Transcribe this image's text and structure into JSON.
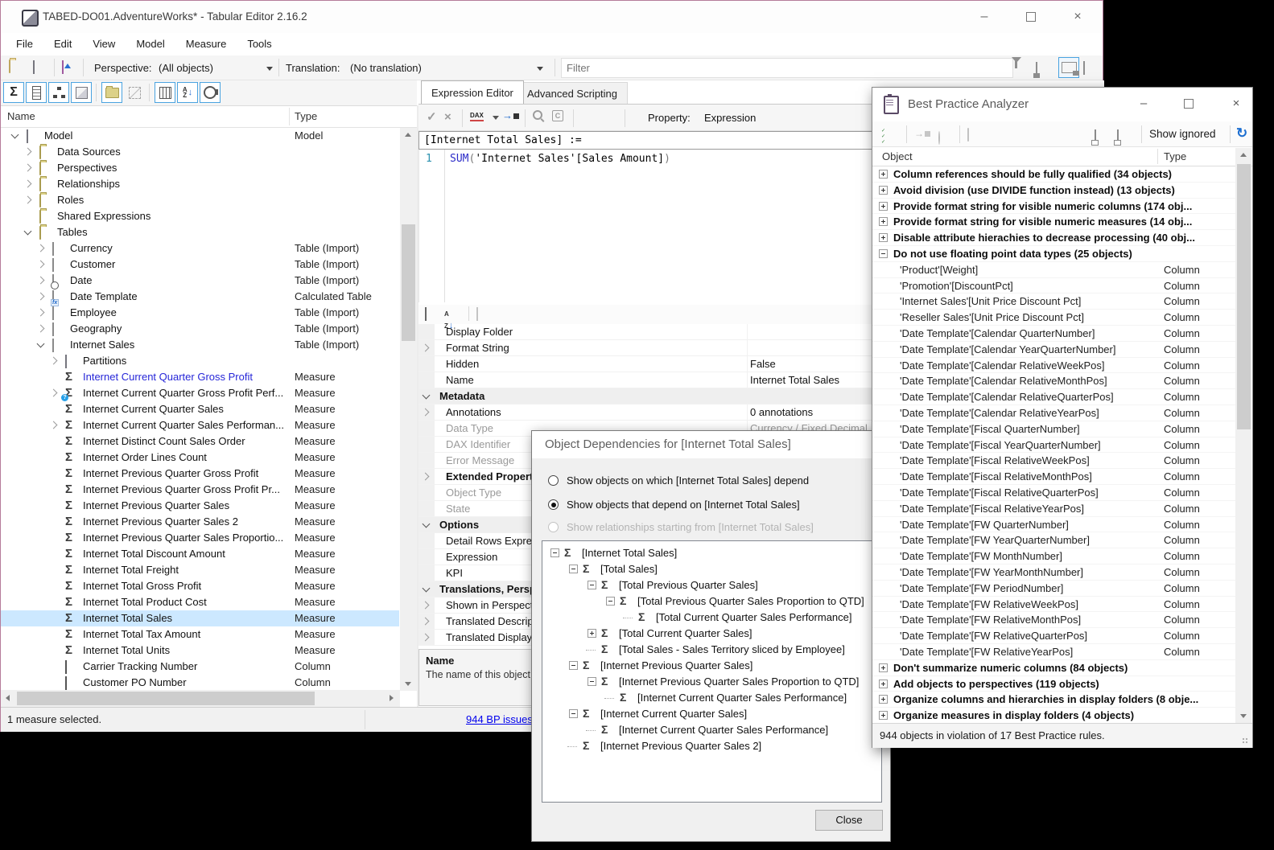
{
  "colors": {
    "selection": "#cce8ff",
    "modified_measure": "#2626d8",
    "accent_toggle_border": "#4aa3e0",
    "link": "#0000ee",
    "dax_keyword": "#2b2bc8",
    "refresh_icon": "#1d6fd1",
    "window_border": "#b57c9a",
    "desktop": "#000000",
    "kpi_badge": "#26a0e8"
  },
  "window": {
    "title": "TABED-DO01.AdventureWorks* - Tabular Editor 2.16.2"
  },
  "menu": {
    "items": [
      "File",
      "Edit",
      "View",
      "Model",
      "Measure",
      "Tools"
    ]
  },
  "toolbar": {
    "perspective_label": "Perspective:",
    "perspective_value": "(All objects)",
    "translation_label": "Translation:",
    "translation_value": "(No translation)",
    "filter_placeholder": "Filter",
    "icons": [
      "open-file-icon",
      "model-icon",
      "deploy-icon",
      "filter-funnel-icon",
      "layout-split-icon",
      "layout-split-active-icon",
      "grid-view-icon"
    ]
  },
  "object_toolbar": {
    "buttons": [
      {
        "icon": "sigma",
        "name": "toggle-measures",
        "active": true
      },
      {
        "icon": "column",
        "name": "toggle-columns",
        "active": true
      },
      {
        "icon": "hierarchy",
        "name": "toggle-hierarchies",
        "active": true
      },
      {
        "icon": "cube",
        "name": "toggle-partitions",
        "active": true
      },
      {
        "icon": "sep"
      },
      {
        "icon": "folder",
        "name": "toggle-display-folders",
        "active": true
      },
      {
        "icon": "dashed",
        "name": "toggle-hidden-objects",
        "active": false
      },
      {
        "icon": "sep"
      },
      {
        "icon": "cols3",
        "name": "toggle-metadata-columns",
        "active": true
      },
      {
        "icon": "az",
        "name": "toggle-alphabetical-sort",
        "active": true
      },
      {
        "icon": "circ",
        "name": "toggle-object-types",
        "active": true
      }
    ]
  },
  "tree": {
    "columns": [
      "Name",
      "Type"
    ],
    "items": [
      {
        "label": "Model",
        "type": "Model",
        "level": 0,
        "icon": "cube",
        "expand": "open"
      },
      {
        "label": "Data Sources",
        "type": "",
        "level": 1,
        "icon": "folder",
        "expand": "closed"
      },
      {
        "label": "Perspectives",
        "type": "",
        "level": 1,
        "icon": "folder",
        "expand": "closed"
      },
      {
        "label": "Relationships",
        "type": "",
        "level": 1,
        "icon": "folder",
        "expand": "closed"
      },
      {
        "label": "Roles",
        "type": "",
        "level": 1,
        "icon": "folder",
        "expand": "closed"
      },
      {
        "label": "Shared Expressions",
        "type": "",
        "level": 1,
        "icon": "folder",
        "expand": "none"
      },
      {
        "label": "Tables",
        "type": "",
        "level": 1,
        "icon": "folder",
        "expand": "open"
      },
      {
        "label": "Currency",
        "type": "Table (Import)",
        "level": 2,
        "icon": "table",
        "expand": "closed"
      },
      {
        "label": "Customer",
        "type": "Table (Import)",
        "level": 2,
        "icon": "table",
        "expand": "closed"
      },
      {
        "label": "Date",
        "type": "Table (Import)",
        "level": 2,
        "icon": "table-clock",
        "expand": "closed"
      },
      {
        "label": "Date Template",
        "type": "Calculated Table",
        "level": 2,
        "icon": "table-fx",
        "expand": "closed"
      },
      {
        "label": "Employee",
        "type": "Table (Import)",
        "level": 2,
        "icon": "table",
        "expand": "closed"
      },
      {
        "label": "Geography",
        "type": "Table (Import)",
        "level": 2,
        "icon": "table",
        "expand": "closed"
      },
      {
        "label": "Internet Sales",
        "type": "Table (Import)",
        "level": 2,
        "icon": "table",
        "expand": "open"
      },
      {
        "label": "Partitions",
        "type": "",
        "level": 3,
        "icon": "cube",
        "expand": "closed"
      },
      {
        "label": "Internet Current Quarter Gross Profit",
        "type": "Measure",
        "level": 3,
        "icon": "sigma",
        "expand": "none",
        "modified": true
      },
      {
        "label": "Internet Current Quarter Gross Profit Perf...",
        "type": "Measure",
        "level": 3,
        "icon": "kpi",
        "expand": "closed"
      },
      {
        "label": "Internet Current Quarter Sales",
        "type": "Measure",
        "level": 3,
        "icon": "sigma",
        "expand": "none"
      },
      {
        "label": "Internet Current Quarter Sales Performan...",
        "type": "Measure",
        "level": 3,
        "icon": "sigma",
        "expand": "closed"
      },
      {
        "label": "Internet Distinct Count Sales Order",
        "type": "Measure",
        "level": 3,
        "icon": "sigma",
        "expand": "none"
      },
      {
        "label": "Internet Order Lines Count",
        "type": "Measure",
        "level": 3,
        "icon": "sigma",
        "expand": "none"
      },
      {
        "label": "Internet Previous Quarter Gross Profit",
        "type": "Measure",
        "level": 3,
        "icon": "sigma",
        "expand": "none"
      },
      {
        "label": "Internet Previous Quarter Gross Profit Pr...",
        "type": "Measure",
        "level": 3,
        "icon": "sigma",
        "expand": "none"
      },
      {
        "label": "Internet Previous Quarter Sales",
        "type": "Measure",
        "level": 3,
        "icon": "sigma",
        "expand": "none"
      },
      {
        "label": "Internet Previous Quarter Sales 2",
        "type": "Measure",
        "level": 3,
        "icon": "sigma",
        "expand": "none"
      },
      {
        "label": "Internet Previous Quarter Sales Proportio...",
        "type": "Measure",
        "level": 3,
        "icon": "sigma",
        "expand": "none"
      },
      {
        "label": "Internet Total Discount Amount",
        "type": "Measure",
        "level": 3,
        "icon": "sigma",
        "expand": "none"
      },
      {
        "label": "Internet Total Freight",
        "type": "Measure",
        "level": 3,
        "icon": "sigma",
        "expand": "none"
      },
      {
        "label": "Internet Total Gross Profit",
        "type": "Measure",
        "level": 3,
        "icon": "sigma",
        "expand": "none"
      },
      {
        "label": "Internet Total Product Cost",
        "type": "Measure",
        "level": 3,
        "icon": "sigma",
        "expand": "none"
      },
      {
        "label": "Internet Total Sales",
        "type": "Measure",
        "level": 3,
        "icon": "sigma",
        "expand": "none",
        "selected": true
      },
      {
        "label": "Internet Total Tax Amount",
        "type": "Measure",
        "level": 3,
        "icon": "sigma",
        "expand": "none"
      },
      {
        "label": "Internet Total Units",
        "type": "Measure",
        "level": 3,
        "icon": "sigma",
        "expand": "none"
      },
      {
        "label": "Carrier Tracking Number",
        "type": "Column",
        "level": 3,
        "icon": "column",
        "expand": "none"
      },
      {
        "label": "Customer PO Number",
        "type": "Column",
        "level": 3,
        "icon": "column",
        "expand": "none"
      }
    ]
  },
  "status": {
    "left": "1 measure selected.",
    "bp_link": "944 BP issues"
  },
  "editor": {
    "tabs": [
      "Expression Editor",
      "Advanced Scripting"
    ],
    "property_label": "Property:",
    "property_value": "Expression",
    "header": "[Internet Total Sales] :=",
    "line_number": "1",
    "code": {
      "keyword": "SUM",
      "open_paren": "(",
      "body": "'Internet Sales'[Sales Amount]",
      "close_paren": ")"
    }
  },
  "properties": {
    "rows": [
      {
        "label": "Display Folder",
        "value": "",
        "kind": "row"
      },
      {
        "label": "Format String",
        "value": "",
        "kind": "row",
        "expander": true
      },
      {
        "label": "Hidden",
        "value": "False",
        "kind": "row"
      },
      {
        "label": "Name",
        "value": "Internet Total Sales",
        "kind": "row"
      },
      {
        "label": "Metadata",
        "kind": "group"
      },
      {
        "label": "Annotations",
        "value": "0 annotations",
        "kind": "row",
        "expander": true
      },
      {
        "label": "Data Type",
        "value": "Currency / Fixed Decimal",
        "kind": "row",
        "readonly": true
      },
      {
        "label": "DAX Identifier",
        "value": "",
        "kind": "row",
        "readonly": true
      },
      {
        "label": "Error Message",
        "value": "",
        "kind": "row",
        "readonly": true
      },
      {
        "label": "Extended Properties",
        "value": "",
        "kind": "row",
        "expander": true,
        "bold": true
      },
      {
        "label": "Object Type",
        "value": "",
        "kind": "row",
        "readonly": true
      },
      {
        "label": "State",
        "value": "",
        "kind": "row",
        "readonly": true
      },
      {
        "label": "Options",
        "kind": "group"
      },
      {
        "label": "Detail Rows Expression",
        "value": "",
        "kind": "row"
      },
      {
        "label": "Expression",
        "value": "",
        "kind": "row"
      },
      {
        "label": "KPI",
        "value": "",
        "kind": "row"
      },
      {
        "label": "Translations, Perspectives",
        "kind": "group"
      },
      {
        "label": "Shown in Perspectives",
        "value": "",
        "kind": "row",
        "expander": true
      },
      {
        "label": "Translated Descriptions",
        "value": "",
        "kind": "row",
        "expander": true
      },
      {
        "label": "Translated Display Folders",
        "value": "",
        "kind": "row",
        "expander": true
      }
    ],
    "description_title": "Name",
    "description_text": "The name of this object"
  },
  "dialog": {
    "title": "Object Dependencies for [Internet Total Sales]",
    "radios": [
      {
        "label": "Show objects on which [Internet Total Sales] depend",
        "selected": false,
        "disabled": false
      },
      {
        "label": "Show objects that depend on [Internet Total Sales]",
        "selected": true,
        "disabled": false
      },
      {
        "label": "Show relationships starting from [Internet Total Sales]",
        "selected": false,
        "disabled": true
      }
    ],
    "tree": [
      {
        "label": "[Internet Total Sales]",
        "level": 0,
        "box": "minus"
      },
      {
        "label": "[Total Sales]",
        "level": 1,
        "box": "minus"
      },
      {
        "label": "[Total Previous Quarter Sales]",
        "level": 2,
        "box": "minus"
      },
      {
        "label": "[Total Previous Quarter Sales Proportion to QTD]",
        "level": 3,
        "box": "minus"
      },
      {
        "label": "[Total Current Quarter Sales Performance]",
        "level": 4,
        "box": "none"
      },
      {
        "label": "[Total Current Quarter Sales]",
        "level": 2,
        "box": "plus"
      },
      {
        "label": "[Total Sales - Sales Territory sliced by Employee]",
        "level": 2,
        "box": "none"
      },
      {
        "label": "[Internet Previous Quarter Sales]",
        "level": 1,
        "box": "minus"
      },
      {
        "label": "[Internet Previous Quarter Sales Proportion to QTD]",
        "level": 2,
        "box": "minus"
      },
      {
        "label": "[Internet Current Quarter Sales Performance]",
        "level": 3,
        "box": "none"
      },
      {
        "label": "[Internet Current Quarter Sales]",
        "level": 1,
        "box": "minus"
      },
      {
        "label": "[Internet Current Quarter Sales Performance]",
        "level": 2,
        "box": "none"
      },
      {
        "label": "[Internet Previous Quarter Sales 2]",
        "level": 1,
        "box": "none"
      }
    ],
    "close_label": "Close"
  },
  "bpa": {
    "title": "Best Practice Analyzer",
    "show_ignored": "Show ignored",
    "columns": [
      "Object",
      "Type"
    ],
    "rows": [
      {
        "kind": "rule",
        "box": "plus",
        "label": "Column references should be fully qualified (34 objects)"
      },
      {
        "kind": "rule",
        "box": "plus",
        "label": "Avoid division (use DIVIDE function instead) (13 objects)"
      },
      {
        "kind": "rule",
        "box": "plus",
        "label": "Provide format string for visible numeric columns (174 obj..."
      },
      {
        "kind": "rule",
        "box": "plus",
        "label": "Provide format string for visible numeric measures (14 obj..."
      },
      {
        "kind": "rule",
        "box": "plus",
        "label": "Disable attribute hierachies to decrease processing (40 obj..."
      },
      {
        "kind": "rule",
        "box": "minus",
        "label": "Do not use floating point data types (25 objects)"
      },
      {
        "kind": "item",
        "label": "'Product'[Weight]",
        "type": "Column"
      },
      {
        "kind": "item",
        "label": "'Promotion'[DiscountPct]",
        "type": "Column"
      },
      {
        "kind": "item",
        "label": "'Internet Sales'[Unit Price Discount Pct]",
        "type": "Column"
      },
      {
        "kind": "item",
        "label": "'Reseller Sales'[Unit Price Discount Pct]",
        "type": "Column"
      },
      {
        "kind": "item",
        "label": "'Date Template'[Calendar QuarterNumber]",
        "type": "Column"
      },
      {
        "kind": "item",
        "label": "'Date Template'[Calendar YearQuarterNumber]",
        "type": "Column"
      },
      {
        "kind": "item",
        "label": "'Date Template'[Calendar RelativeWeekPos]",
        "type": "Column"
      },
      {
        "kind": "item",
        "label": "'Date Template'[Calendar RelativeMonthPos]",
        "type": "Column"
      },
      {
        "kind": "item",
        "label": "'Date Template'[Calendar RelativeQuarterPos]",
        "type": "Column"
      },
      {
        "kind": "item",
        "label": "'Date Template'[Calendar RelativeYearPos]",
        "type": "Column"
      },
      {
        "kind": "item",
        "label": "'Date Template'[Fiscal QuarterNumber]",
        "type": "Column"
      },
      {
        "kind": "item",
        "label": "'Date Template'[Fiscal YearQuarterNumber]",
        "type": "Column"
      },
      {
        "kind": "item",
        "label": "'Date Template'[Fiscal RelativeWeekPos]",
        "type": "Column"
      },
      {
        "kind": "item",
        "label": "'Date Template'[Fiscal RelativeMonthPos]",
        "type": "Column"
      },
      {
        "kind": "item",
        "label": "'Date Template'[Fiscal RelativeQuarterPos]",
        "type": "Column"
      },
      {
        "kind": "item",
        "label": "'Date Template'[Fiscal RelativeYearPos]",
        "type": "Column"
      },
      {
        "kind": "item",
        "label": "'Date Template'[FW QuarterNumber]",
        "type": "Column"
      },
      {
        "kind": "item",
        "label": "'Date Template'[FW YearQuarterNumber]",
        "type": "Column"
      },
      {
        "kind": "item",
        "label": "'Date Template'[FW MonthNumber]",
        "type": "Column"
      },
      {
        "kind": "item",
        "label": "'Date Template'[FW YearMonthNumber]",
        "type": "Column"
      },
      {
        "kind": "item",
        "label": "'Date Template'[FW PeriodNumber]",
        "type": "Column"
      },
      {
        "kind": "item",
        "label": "'Date Template'[FW RelativeWeekPos]",
        "type": "Column"
      },
      {
        "kind": "item",
        "label": "'Date Template'[FW RelativeMonthPos]",
        "type": "Column"
      },
      {
        "kind": "item",
        "label": "'Date Template'[FW RelativeQuarterPos]",
        "type": "Column"
      },
      {
        "kind": "item",
        "label": "'Date Template'[FW RelativeYearPos]",
        "type": "Column"
      },
      {
        "kind": "rule",
        "box": "plus",
        "label": "Don't summarize numeric columns (84 objects)"
      },
      {
        "kind": "rule",
        "box": "plus",
        "label": "Add objects to perspectives (119 objects)"
      },
      {
        "kind": "rule",
        "box": "plus",
        "label": "Organize columns and hierarchies in display folders (8 obje..."
      },
      {
        "kind": "rule",
        "box": "plus",
        "label": "Organize measures in display folders (4 objects)"
      }
    ],
    "status": "944 objects in violation of 17 Best Practice rules."
  }
}
